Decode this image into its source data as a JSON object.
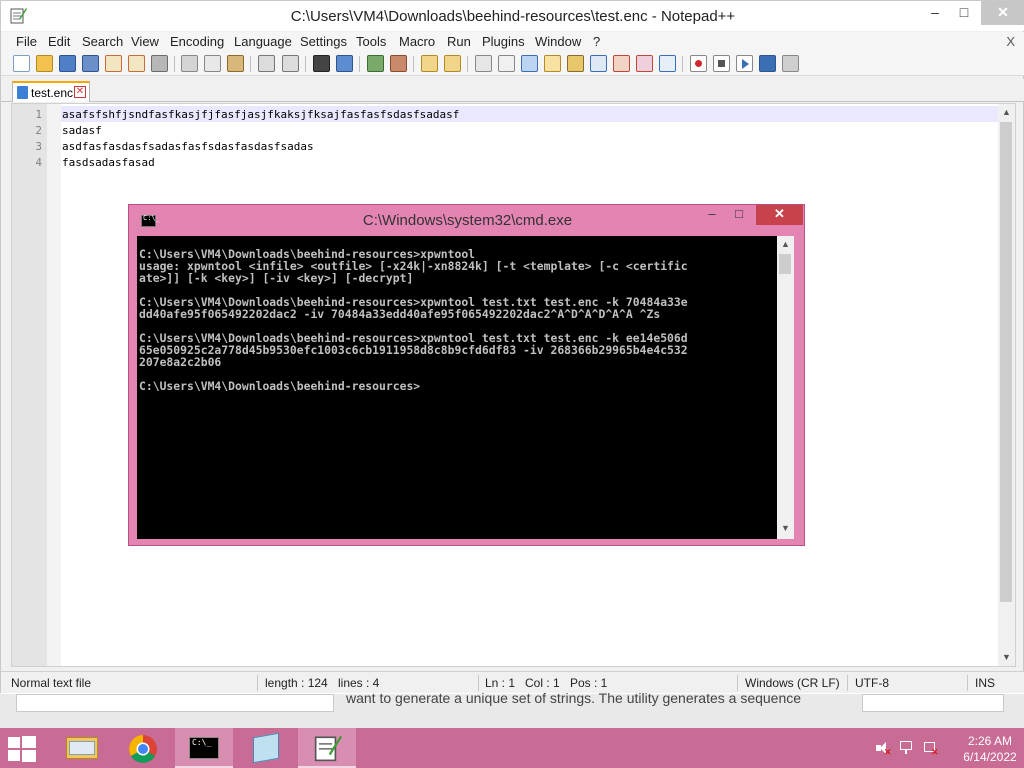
{
  "window": {
    "title": "C:\\Users\\VM4\\Downloads\\beehind-resources\\test.enc - Notepad++",
    "min_glyph": "–",
    "max_glyph": "□",
    "close_glyph": "✕"
  },
  "menu": {
    "items": [
      "File",
      "Edit",
      "Search",
      "View",
      "Encoding",
      "Language",
      "Settings",
      "Tools",
      "Macro",
      "Run",
      "Plugins",
      "Window",
      "?"
    ],
    "close_x": "X"
  },
  "toolbar": {
    "icons": [
      "new-file-icon",
      "open-file-icon",
      "save-icon",
      "save-all-icon",
      "close-icon",
      "close-all-icon",
      "print-icon",
      "cut-icon",
      "copy-icon",
      "paste-icon",
      "undo-icon",
      "redo-icon",
      "find-icon",
      "replace-icon",
      "zoom-in-icon",
      "zoom-out-icon",
      "sync-vertical-icon",
      "sync-horizontal-icon",
      "word-wrap-icon",
      "show-all-chars-icon",
      "indent-guide-icon",
      "doc-map-icon",
      "function-list-icon",
      "folder-workspace-icon",
      "monitoring-icon",
      "record-macro-icon",
      "stop-macro-icon",
      "play-macro-icon",
      "run-macro-multiple-icon",
      "save-macro-icon"
    ]
  },
  "tab": {
    "label": "test.enc",
    "close_glyph": "✕"
  },
  "editor": {
    "lines": [
      {
        "num": "1",
        "text": "asafsfshfjsndfasfkasjfjfasfjasjfkaksjfksajfasfasfsdasfsadasf"
      },
      {
        "num": "2",
        "text": "sadasf"
      },
      {
        "num": "3",
        "text": "asdfasfasdasfsadasfasfsdasfasdasfsadas"
      },
      {
        "num": "4",
        "text": "fasdsadasfasad"
      }
    ]
  },
  "statusbar": {
    "file_type": "Normal text file",
    "length": "length : 124",
    "lines": "lines : 4",
    "ln": "Ln : 1",
    "col": "Col : 1",
    "pos": "Pos : 1",
    "eol": "Windows (CR LF)",
    "encoding": "UTF-8",
    "ins": "INS"
  },
  "behind": {
    "text": "want to generate a unique set of strings. The utility generates a sequence"
  },
  "cmd": {
    "title": "C:\\Windows\\system32\\cmd.exe",
    "icon_glyph": "C:\\_",
    "min_glyph": "–",
    "max_glyph": "□",
    "close_glyph": "✕",
    "lines": [
      "C:\\Users\\VM4\\Downloads\\beehind-resources>xpwntool",
      "usage: xpwntool <infile> <outfile> [-x24k|-xn8824k] [-t <template> [-c <certific",
      "ate>]] [-k <key>] [-iv <key>] [-decrypt]",
      "",
      "C:\\Users\\VM4\\Downloads\\beehind-resources>xpwntool test.txt test.enc -k 70484a33e",
      "dd40afe95f065492202dac2 -iv 70484a33edd40afe95f065492202dac2^A^D^A^D^A^A ^Zs",
      "",
      "C:\\Users\\VM4\\Downloads\\beehind-resources>xpwntool test.txt test.enc -k ee14e506d",
      "65e050925c2a778d45b9530efc1003c6cb1911958d8c8b9cfd6df83 -iv 268366b29965b4e4c532",
      "207e8a2c2b06",
      "",
      "C:\\Users\\VM4\\Downloads\\beehind-resources>"
    ]
  },
  "taskbar": {
    "apps": [
      "file-explorer-icon",
      "chrome-icon",
      "cmd-icon",
      "notepad-icon",
      "notepad-plus-plus-icon"
    ],
    "clock_time": "2:26 AM",
    "clock_date": "6/14/2022"
  }
}
